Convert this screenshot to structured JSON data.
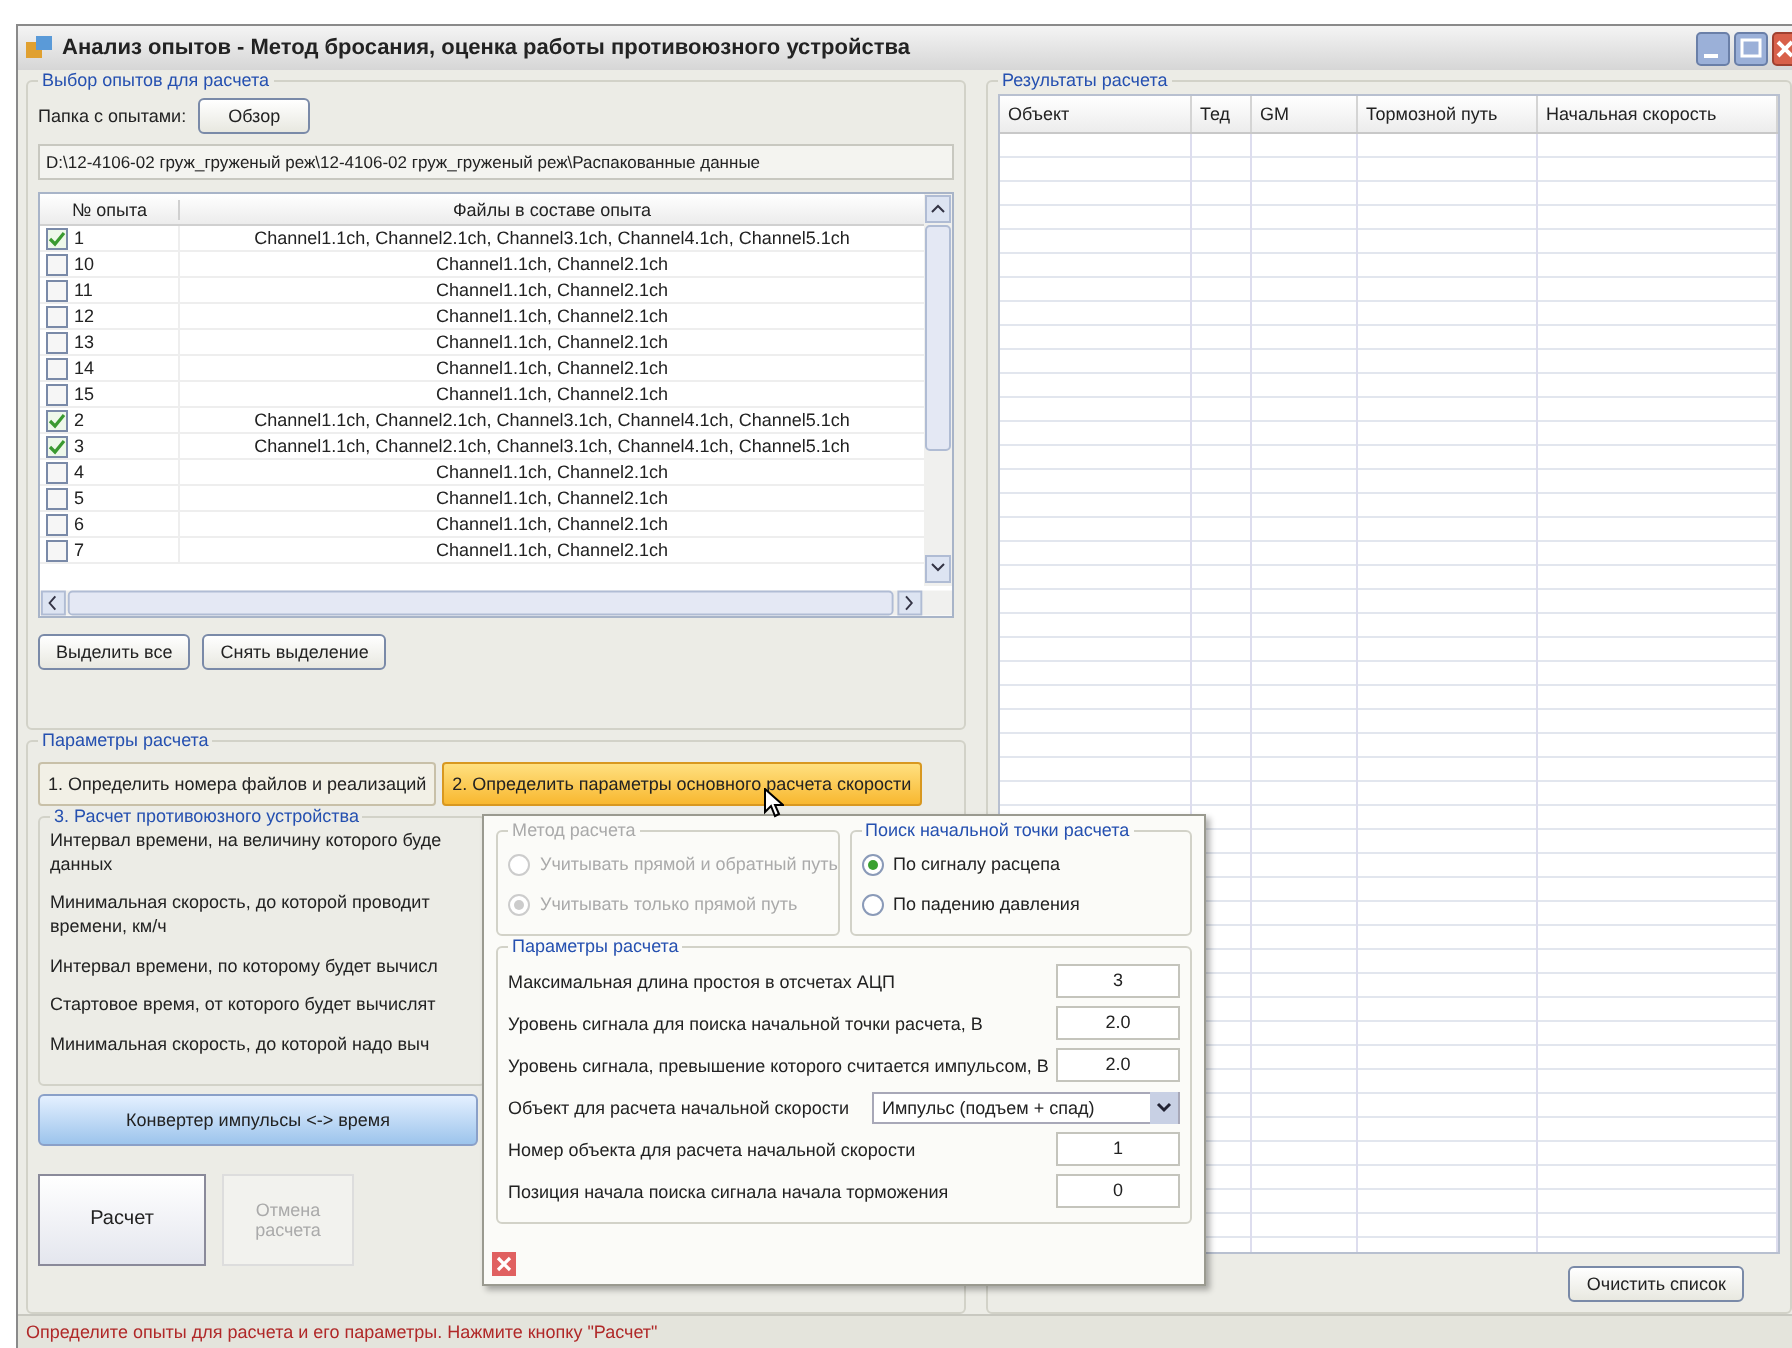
{
  "window": {
    "title": "Анализ опытов - Метод бросания, оценка работы противоюзного устройства"
  },
  "experiments": {
    "title": "Выбор опытов для расчета",
    "folder_label": "Папка с опытами:",
    "browse_button": "Обзор",
    "path": "D:\\12-4106-02 груж_груженый реж\\12-4106-02 груж_груженый реж\\Распакованные данные",
    "columns": [
      "№ опыта",
      "Файлы в составе опыта"
    ],
    "rows": [
      {
        "number": "1",
        "checked": true,
        "files": "Channel1.1ch, Channel2.1ch, Channel3.1ch, Channel4.1ch, Channel5.1ch"
      },
      {
        "number": "10",
        "checked": false,
        "files": "Channel1.1ch, Channel2.1ch"
      },
      {
        "number": "11",
        "checked": false,
        "files": "Channel1.1ch, Channel2.1ch"
      },
      {
        "number": "12",
        "checked": false,
        "files": "Channel1.1ch, Channel2.1ch"
      },
      {
        "number": "13",
        "checked": false,
        "files": "Channel1.1ch, Channel2.1ch"
      },
      {
        "number": "14",
        "checked": false,
        "files": "Channel1.1ch, Channel2.1ch"
      },
      {
        "number": "15",
        "checked": false,
        "files": "Channel1.1ch, Channel2.1ch"
      },
      {
        "number": "2",
        "checked": true,
        "files": "Channel1.1ch, Channel2.1ch, Channel3.1ch, Channel4.1ch, Channel5.1ch"
      },
      {
        "number": "3",
        "checked": true,
        "files": "Channel1.1ch, Channel2.1ch, Channel3.1ch, Channel4.1ch, Channel5.1ch"
      },
      {
        "number": "4",
        "checked": false,
        "files": "Channel1.1ch, Channel2.1ch"
      },
      {
        "number": "5",
        "checked": false,
        "files": "Channel1.1ch, Channel2.1ch"
      },
      {
        "number": "6",
        "checked": false,
        "files": "Channel1.1ch, Channel2.1ch"
      },
      {
        "number": "7",
        "checked": false,
        "files": "Channel1.1ch, Channel2.1ch"
      }
    ],
    "buttons": [
      "Выделить все",
      "Снять выделение"
    ]
  },
  "parameters": {
    "title": "Параметры расчета",
    "tabs": [
      {
        "label": "1. Определить номера файлов и реализаций",
        "selected": false
      },
      {
        "label": "2. Определить параметры основного расчета скорости",
        "selected": true
      }
    ],
    "section": {
      "title": "3. Расчет противоюзного устройства",
      "labels": [
        {
          "lines": [
            "Интервал времени, на величину которого буде",
            "данных"
          ]
        },
        {
          "lines": [
            "Минимальная скорость, до которой проводит",
            "времени, км/ч"
          ]
        },
        {
          "lines": [
            "Интервал времени, по которому будет вычисл"
          ]
        },
        {
          "lines": [
            "Стартовое время, от которого будет вычислят"
          ]
        },
        {
          "lines": [
            "Минимальная скорость, до которой надо выч"
          ]
        }
      ]
    },
    "converter_button": "Конвертер импульсы <-> время"
  },
  "calculate_button": "Расчет",
  "cancel_button": {
    "label": "Отмена расчета",
    "disabled": true
  },
  "popup": {
    "method": {
      "title": "Метод расчета",
      "disabled": true,
      "options": [
        {
          "label": "Учитывать прямой и обратный путь",
          "selected": false
        },
        {
          "label": "Учитывать только прямой путь",
          "selected": true
        }
      ]
    },
    "start_search": {
      "title": "Поиск начальной точки расчета",
      "disabled": false,
      "options": [
        {
          "label": "По сигналу расцепа",
          "selected": true
        },
        {
          "label": "По падению давления",
          "selected": false
        }
      ]
    },
    "params": {
      "title": "Параметры расчета",
      "items": [
        {
          "kind": "field",
          "label": "Максимальная длина простоя в отсчетах АЦП",
          "value": "3"
        },
        {
          "kind": "field",
          "label": "Уровень сигнала для поиска начальной точки расчета, В",
          "value": "2.0"
        },
        {
          "kind": "field",
          "label": "Уровень сигнала, превышение которого считается импульсом, В",
          "value": "2.0"
        },
        {
          "kind": "select",
          "label": "Объект для расчета начальной скорости",
          "value": "Импульс (подъем + спад)"
        },
        {
          "kind": "field",
          "label": "Номер объекта для расчета начальной скорости",
          "value": "1"
        },
        {
          "kind": "field",
          "label": "Позиция начала поиска сигнала начала торможения",
          "value": "0"
        }
      ]
    }
  },
  "results": {
    "title": "Результаты расчета",
    "columns": [
      "Объект",
      "Тед",
      "GM",
      "Тормозной путь",
      "Начальная скорость"
    ],
    "clear_button": "Очистить список"
  },
  "status_bar": "Определите опыты для расчета и его параметры. Нажмите кнопку \"Расчет\""
}
